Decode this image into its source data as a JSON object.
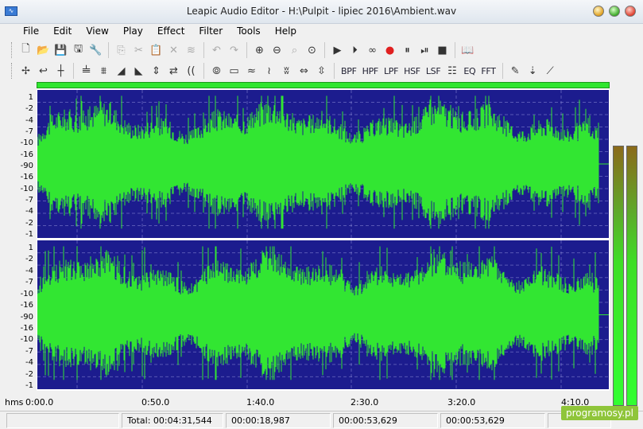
{
  "window": {
    "title": "Leapic Audio Editor - H:\\Pulpit - lipiec 2016\\Ambient.wav"
  },
  "menu": [
    "File",
    "Edit",
    "View",
    "Play",
    "Effect",
    "Filter",
    "Tools",
    "Help"
  ],
  "toolbar1": [
    {
      "name": "new-file-icon",
      "glyph": "🗋",
      "enabled": true
    },
    {
      "name": "open-file-icon",
      "glyph": "📂",
      "enabled": true
    },
    {
      "name": "save-icon",
      "glyph": "💾",
      "enabled": true
    },
    {
      "name": "save-as-icon",
      "glyph": "🖫",
      "enabled": true
    },
    {
      "name": "properties-icon",
      "glyph": "🔧",
      "enabled": true
    },
    {
      "sep": true
    },
    {
      "name": "copy-icon",
      "glyph": "⎘",
      "enabled": false
    },
    {
      "name": "cut-icon",
      "glyph": "✂",
      "enabled": false
    },
    {
      "name": "paste-icon",
      "glyph": "📋",
      "enabled": false
    },
    {
      "name": "delete-icon",
      "glyph": "✕",
      "enabled": false
    },
    {
      "name": "mix-paste-icon",
      "glyph": "≋",
      "enabled": false
    },
    {
      "sep": true
    },
    {
      "name": "undo-icon",
      "glyph": "↶",
      "enabled": false
    },
    {
      "name": "redo-icon",
      "glyph": "↷",
      "enabled": false
    },
    {
      "sep": true
    },
    {
      "name": "zoom-in-icon",
      "glyph": "⊕",
      "enabled": true
    },
    {
      "name": "zoom-out-icon",
      "glyph": "⊖",
      "enabled": true
    },
    {
      "name": "zoom-selection-icon",
      "glyph": "⌕",
      "enabled": false
    },
    {
      "name": "zoom-all-icon",
      "glyph": "⊙",
      "enabled": true
    },
    {
      "sep": true
    },
    {
      "name": "play-icon",
      "glyph": "▶",
      "enabled": true
    },
    {
      "name": "play-from-icon",
      "glyph": "⏵",
      "enabled": true
    },
    {
      "name": "loop-icon",
      "glyph": "∞",
      "enabled": true
    },
    {
      "name": "record-icon",
      "glyph": "●",
      "enabled": true,
      "color": "#e02020"
    },
    {
      "name": "pause-icon",
      "glyph": "⏸",
      "enabled": true
    },
    {
      "name": "play-pause-icon",
      "glyph": "⏯",
      "enabled": true
    },
    {
      "name": "stop-icon",
      "glyph": "■",
      "enabled": true
    },
    {
      "sep": true
    },
    {
      "name": "help-book-icon",
      "glyph": "📖",
      "enabled": true
    }
  ],
  "toolbar2": [
    {
      "name": "trim-icon",
      "glyph": "✢",
      "enabled": true
    },
    {
      "name": "undo-effect-icon",
      "glyph": "↩",
      "enabled": true
    },
    {
      "name": "split-icon",
      "glyph": "┼",
      "enabled": true
    },
    {
      "sep": true
    },
    {
      "name": "amplify-icon",
      "glyph": "𝍧",
      "enabled": true
    },
    {
      "name": "normalize-icon",
      "glyph": "⩩",
      "enabled": true
    },
    {
      "name": "fade-in-icon",
      "glyph": "◢",
      "enabled": true
    },
    {
      "name": "fade-out-icon",
      "glyph": "◣",
      "enabled": true
    },
    {
      "name": "vertical-swap-icon",
      "glyph": "⇕",
      "enabled": true
    },
    {
      "name": "reverse-icon",
      "glyph": "⇄",
      "enabled": true
    },
    {
      "name": "echo-icon",
      "glyph": "((",
      "enabled": true
    },
    {
      "sep": true
    },
    {
      "name": "chorus-icon",
      "glyph": "⦾",
      "enabled": true
    },
    {
      "name": "silence-icon",
      "glyph": "▭",
      "enabled": true
    },
    {
      "name": "noise-icon",
      "glyph": "≈",
      "enabled": true
    },
    {
      "name": "distortion-icon",
      "glyph": "≀",
      "enabled": true
    },
    {
      "name": "flanger-icon",
      "glyph": "ʬ",
      "enabled": true
    },
    {
      "name": "speed-icon",
      "glyph": "⇔",
      "enabled": true
    },
    {
      "name": "pitch-icon",
      "glyph": "⇳",
      "enabled": true
    },
    {
      "sep": true
    },
    {
      "name": "bpf-icon",
      "text": "BPF",
      "enabled": true
    },
    {
      "name": "hpf-icon",
      "text": "HPF",
      "enabled": true
    },
    {
      "name": "lpf-icon",
      "text": "LPF",
      "enabled": true
    },
    {
      "name": "hsf-icon",
      "text": "HSF",
      "enabled": true
    },
    {
      "name": "lsf-icon",
      "text": "LSF",
      "enabled": true
    },
    {
      "name": "eq-icon",
      "glyph": "☷",
      "enabled": true
    },
    {
      "name": "eq2-icon",
      "text": "EQ",
      "enabled": true
    },
    {
      "name": "fft-icon",
      "text": "FFT",
      "enabled": true
    },
    {
      "sep": true
    },
    {
      "name": "batch-icon",
      "glyph": "✎",
      "enabled": true
    },
    {
      "name": "convert-icon",
      "glyph": "⇣",
      "enabled": true
    },
    {
      "name": "tag-edit-icon",
      "glyph": "⟋",
      "enabled": true
    }
  ],
  "scale_labels": [
    "1",
    "-2",
    "-4",
    "-7",
    "-10",
    "-16",
    "-90",
    "-16",
    "-10",
    "-7",
    "-4",
    "-2",
    "-1"
  ],
  "timeline": {
    "unit": "hms",
    "labels": [
      "0:00.0",
      "0:50.0",
      "1:40.0",
      "2:30.0",
      "3:20.0",
      "4:10.0"
    ]
  },
  "status": {
    "total": "Total: 00:04:31,544",
    "position": "00:00:18,987",
    "selection_start": "00:00:53,629",
    "selection_end": "00:00:53,629",
    "extra": ""
  },
  "colors": {
    "wave_bg": "#1c1c8e",
    "waveform": "#32e632",
    "grid": "#c8c8ff"
  },
  "watermark": "programosy.pl"
}
